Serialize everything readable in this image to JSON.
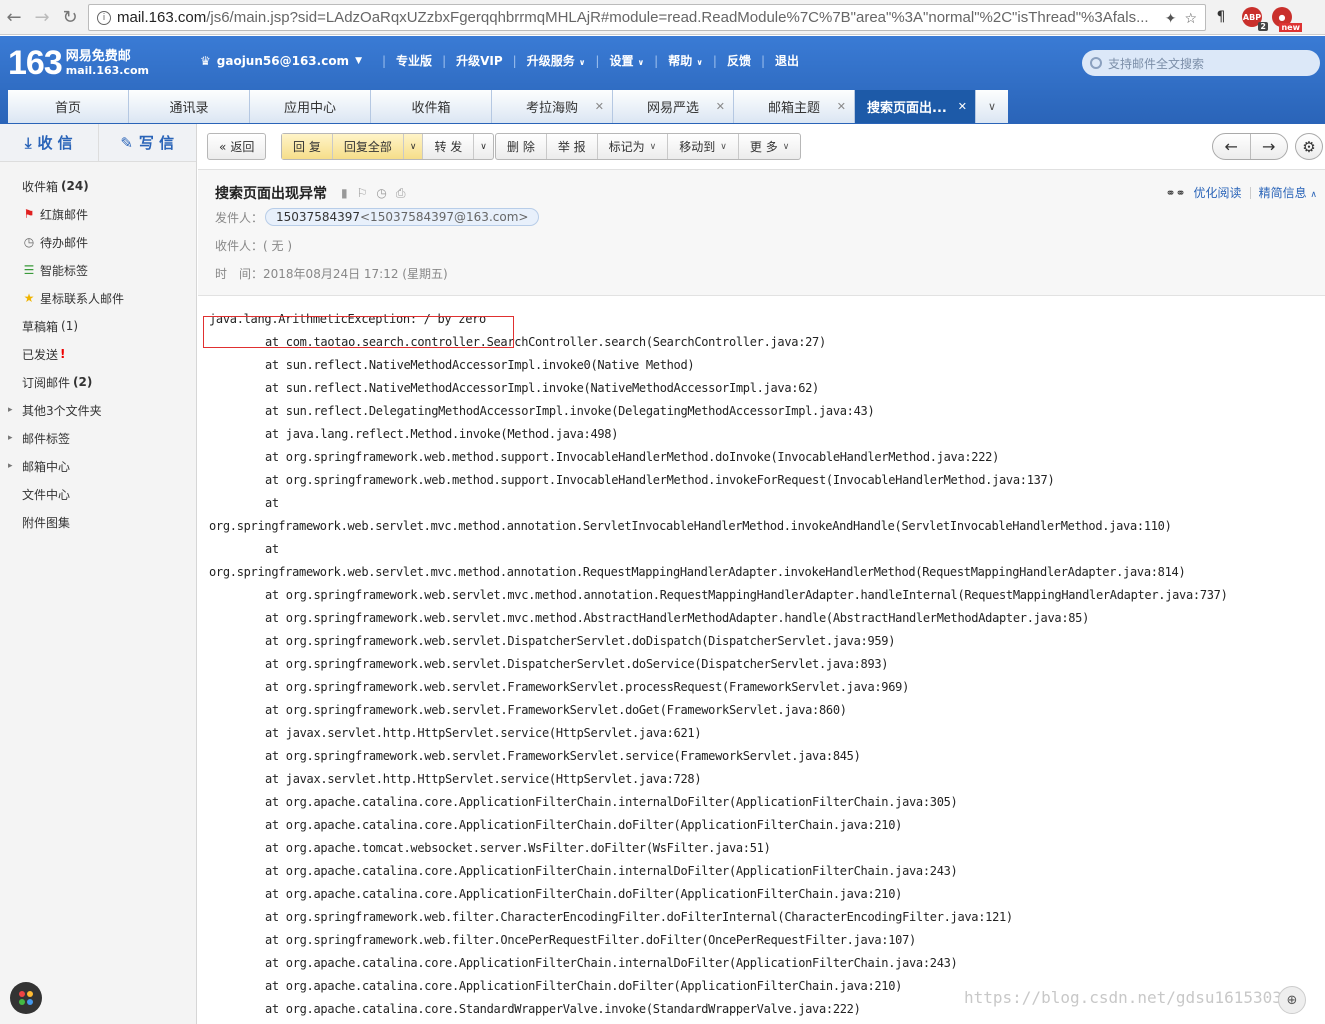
{
  "browser": {
    "url_host": "mail.163.com",
    "url_rest": "/js6/main.jsp?sid=LAdzOaRqxUZzbxFgerqqhbrrmqMHLAjR#module=read.ReadModule%7C%7B\"area\"%3A\"normal\"%2C\"isThread\"%3Afals...",
    "ext_abp_badge": "2",
    "ext_new_badge": "new"
  },
  "header": {
    "logo_num": "163",
    "logo_line1": "网易免费邮",
    "logo_line2": "mail.163.com",
    "user": "gaojun56@163.com",
    "nav": [
      "专业版",
      "升级VIP",
      "升级服务",
      "设置",
      "帮助",
      "反馈",
      "退出"
    ],
    "search_placeholder": "支持邮件全文搜索"
  },
  "tabs": [
    {
      "label": "首页"
    },
    {
      "label": "通讯录"
    },
    {
      "label": "应用中心"
    },
    {
      "label": "收件箱"
    },
    {
      "label": "考拉海购"
    },
    {
      "label": "网易严选"
    },
    {
      "label": "邮箱主题"
    },
    {
      "label": "搜索页面出..."
    }
  ],
  "sidebar": {
    "receive": "收 信",
    "write": "写 信",
    "folders": [
      {
        "label": "收件箱",
        "count": "(24)"
      },
      {
        "label": "红旗邮件"
      },
      {
        "label": "待办邮件"
      },
      {
        "label": "智能标签"
      },
      {
        "label": "星标联系人邮件"
      },
      {
        "label": "草稿箱",
        "count": "(1)"
      },
      {
        "label": "已发送",
        "bang": "!"
      },
      {
        "label": "订阅邮件",
        "count": "(2)"
      },
      {
        "label": "其他3个文件夹"
      },
      {
        "label": "邮件标签"
      },
      {
        "label": "邮箱中心"
      },
      {
        "label": "文件中心"
      },
      {
        "label": "附件图集"
      }
    ]
  },
  "toolbar": {
    "back": "返回",
    "reply": "回 复",
    "reply_all": "回复全部",
    "forward": "转 发",
    "delete": "删 除",
    "report": "举 报",
    "mark_as": "标记为",
    "move_to": "移动到",
    "more": "更 多"
  },
  "mail": {
    "subject": "搜索页面出现异常",
    "optimize_read": "优化阅读",
    "brief_info": "精简信息",
    "from_label": "发件人：",
    "from_name": "15037584397",
    "from_addr": "<15037584397@163.com>",
    "to_label": "收件人：",
    "to_value": "( 无 )",
    "time_label": "时　间：",
    "time_value": "2018年08月24日 17:12 (星期五)"
  },
  "trace": [
    {
      "text": "java.lang.ArithmeticException: / by zero",
      "indent": false
    },
    {
      "text": "at com.taotao.search.controller.SearchController.search(SearchController.java:27)",
      "indent": true
    },
    {
      "text": "at sun.reflect.NativeMethodAccessorImpl.invoke0(Native Method)",
      "indent": true
    },
    {
      "text": "at sun.reflect.NativeMethodAccessorImpl.invoke(NativeMethodAccessorImpl.java:62)",
      "indent": true
    },
    {
      "text": "at sun.reflect.DelegatingMethodAccessorImpl.invoke(DelegatingMethodAccessorImpl.java:43)",
      "indent": true
    },
    {
      "text": "at java.lang.reflect.Method.invoke(Method.java:498)",
      "indent": true
    },
    {
      "text": "at org.springframework.web.method.support.InvocableHandlerMethod.doInvoke(InvocableHandlerMethod.java:222)",
      "indent": true
    },
    {
      "text": "at org.springframework.web.method.support.InvocableHandlerMethod.invokeForRequest(InvocableHandlerMethod.java:137)",
      "indent": true
    },
    {
      "text": "at",
      "indent": true
    },
    {
      "text": "org.springframework.web.servlet.mvc.method.annotation.ServletInvocableHandlerMethod.invokeAndHandle(ServletInvocableHandlerMethod.java:110)",
      "indent": false
    },
    {
      "text": "at",
      "indent": true
    },
    {
      "text": "org.springframework.web.servlet.mvc.method.annotation.RequestMappingHandlerAdapter.invokeHandlerMethod(RequestMappingHandlerAdapter.java:814)",
      "indent": false
    },
    {
      "text": "at org.springframework.web.servlet.mvc.method.annotation.RequestMappingHandlerAdapter.handleInternal(RequestMappingHandlerAdapter.java:737)",
      "indent": true
    },
    {
      "text": "at org.springframework.web.servlet.mvc.method.AbstractHandlerMethodAdapter.handle(AbstractHandlerMethodAdapter.java:85)",
      "indent": true
    },
    {
      "text": "at org.springframework.web.servlet.DispatcherServlet.doDispatch(DispatcherServlet.java:959)",
      "indent": true
    },
    {
      "text": "at org.springframework.web.servlet.DispatcherServlet.doService(DispatcherServlet.java:893)",
      "indent": true
    },
    {
      "text": "at org.springframework.web.servlet.FrameworkServlet.processRequest(FrameworkServlet.java:969)",
      "indent": true
    },
    {
      "text": "at org.springframework.web.servlet.FrameworkServlet.doGet(FrameworkServlet.java:860)",
      "indent": true
    },
    {
      "text": "at javax.servlet.http.HttpServlet.service(HttpServlet.java:621)",
      "indent": true
    },
    {
      "text": "at org.springframework.web.servlet.FrameworkServlet.service(FrameworkServlet.java:845)",
      "indent": true
    },
    {
      "text": "at javax.servlet.http.HttpServlet.service(HttpServlet.java:728)",
      "indent": true
    },
    {
      "text": "at org.apache.catalina.core.ApplicationFilterChain.internalDoFilter(ApplicationFilterChain.java:305)",
      "indent": true
    },
    {
      "text": "at org.apache.catalina.core.ApplicationFilterChain.doFilter(ApplicationFilterChain.java:210)",
      "indent": true
    },
    {
      "text": "at org.apache.tomcat.websocket.server.WsFilter.doFilter(WsFilter.java:51)",
      "indent": true
    },
    {
      "text": "at org.apache.catalina.core.ApplicationFilterChain.internalDoFilter(ApplicationFilterChain.java:243)",
      "indent": true
    },
    {
      "text": "at org.apache.catalina.core.ApplicationFilterChain.doFilter(ApplicationFilterChain.java:210)",
      "indent": true
    },
    {
      "text": "at org.springframework.web.filter.CharacterEncodingFilter.doFilterInternal(CharacterEncodingFilter.java:121)",
      "indent": true
    },
    {
      "text": "at org.springframework.web.filter.OncePerRequestFilter.doFilter(OncePerRequestFilter.java:107)",
      "indent": true
    },
    {
      "text": "at org.apache.catalina.core.ApplicationFilterChain.internalDoFilter(ApplicationFilterChain.java:243)",
      "indent": true
    },
    {
      "text": "at org.apache.catalina.core.ApplicationFilterChain.doFilter(ApplicationFilterChain.java:210)",
      "indent": true
    },
    {
      "text": "at org.apache.catalina.core.StandardWrapperValve.invoke(StandardWrapperValve.java:222)",
      "indent": true
    }
  ],
  "watermark": "https://blog.csdn.net/gdsu16153037",
  "colors": {
    "brand_blue": "#2a64b8",
    "active_tab": "#1d5aa8",
    "highlight_red": "#e03030"
  }
}
